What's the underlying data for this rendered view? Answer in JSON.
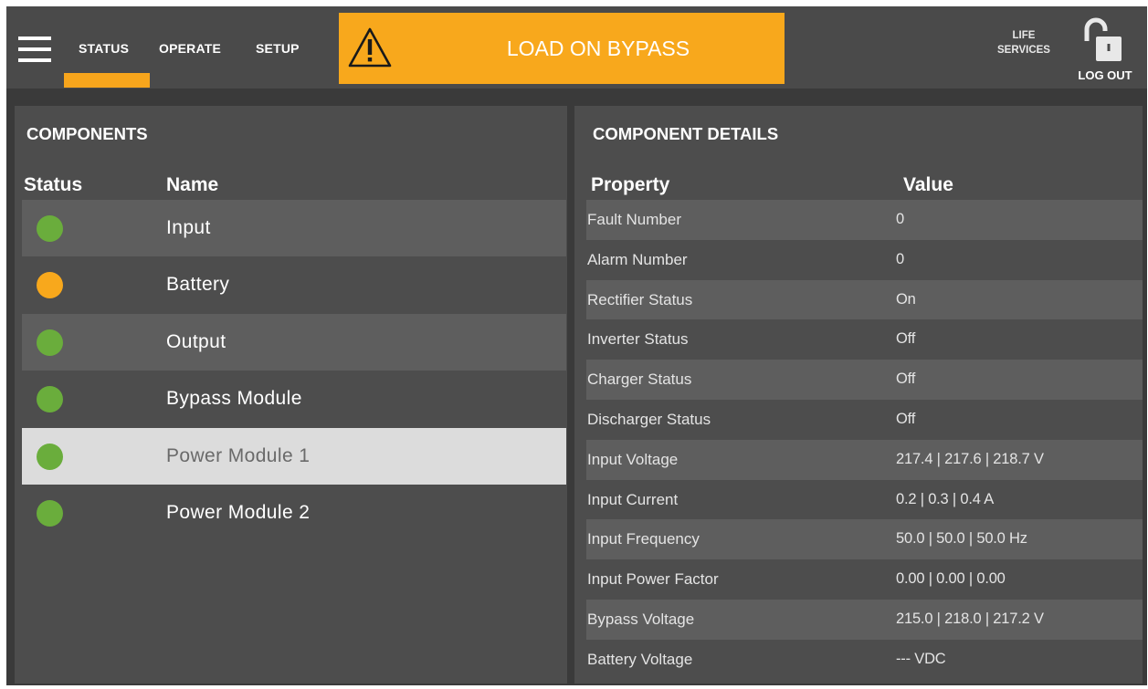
{
  "nav": {
    "tabs": [
      "STATUS",
      "OPERATE",
      "SETUP"
    ],
    "active_tab": "STATUS"
  },
  "alarm": {
    "text": "LOAD ON BYPASS",
    "icon": "warning-icon",
    "color": "#f8a81c"
  },
  "header": {
    "life_services": "LIFE SERVICES",
    "logout": "LOG OUT",
    "logout_icon": "unlocked-padlock-icon"
  },
  "components": {
    "title": "COMPONENTS",
    "columns": {
      "status": "Status",
      "name": "Name"
    },
    "items": [
      {
        "name": "Input",
        "status_color": "#6aad3c"
      },
      {
        "name": "Battery",
        "status_color": "#f8a81c"
      },
      {
        "name": "Output",
        "status_color": "#6aad3c"
      },
      {
        "name": "Bypass Module",
        "status_color": "#6aad3c"
      },
      {
        "name": "Power Module 1",
        "status_color": "#6aad3c",
        "selected": true
      },
      {
        "name": "Power Module 2",
        "status_color": "#6aad3c"
      }
    ]
  },
  "details": {
    "title": "COMPONENT DETAILS",
    "columns": {
      "property": "Property",
      "value": "Value"
    },
    "rows": [
      {
        "property": "Fault Number",
        "value": "0"
      },
      {
        "property": "Alarm Number",
        "value": "0"
      },
      {
        "property": "Rectifier Status",
        "value": "On"
      },
      {
        "property": "Inverter Status",
        "value": "Off"
      },
      {
        "property": "Charger Status",
        "value": "Off"
      },
      {
        "property": "Discharger Status",
        "value": "Off"
      },
      {
        "property": "Input Voltage",
        "value": "217.4 | 217.6 | 218.7 V"
      },
      {
        "property": "Input Current",
        "value": "0.2 | 0.3 | 0.4 A"
      },
      {
        "property": "Input Frequency",
        "value": "50.0 | 50.0 | 50.0 Hz"
      },
      {
        "property": "Input Power Factor",
        "value": "0.00 | 0.00 | 0.00"
      },
      {
        "property": "Bypass Voltage",
        "value": "215.0 | 218.0 | 217.2 V"
      },
      {
        "property": "Battery Voltage",
        "value": "--- VDC"
      }
    ]
  }
}
